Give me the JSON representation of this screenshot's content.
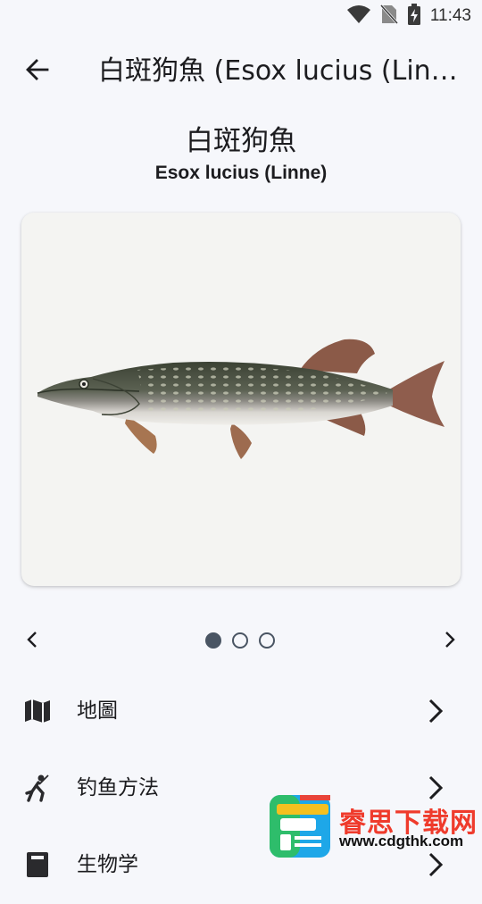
{
  "status_bar": {
    "time": "11:43",
    "icons": [
      "wifi-icon",
      "no-sim-icon",
      "battery-charging-icon"
    ]
  },
  "app_bar": {
    "back_icon": "arrow-left-icon",
    "title": "白斑狗魚 (Esox lucius (Linne)"
  },
  "fish": {
    "name_zh": "白斑狗魚",
    "name_latin": "Esox lucius (Linne)",
    "image": "northern-pike-illustration"
  },
  "pager": {
    "prev_icon": "chevron-left-icon",
    "next_icon": "chevron-right-icon",
    "pages": 3,
    "current": 1
  },
  "menu": [
    {
      "label": "地圖",
      "icon": "map-icon"
    },
    {
      "label": "钓鱼方法",
      "icon": "fishing-person-icon"
    },
    {
      "label": "生物学",
      "icon": "book-icon"
    }
  ],
  "watermark": {
    "title": "睿思下载网",
    "url": "www.cdgthk.com"
  },
  "colors": {
    "background": "#f6f7fb",
    "dot": "#4a5563",
    "watermark_red": "#ef3b2c"
  }
}
